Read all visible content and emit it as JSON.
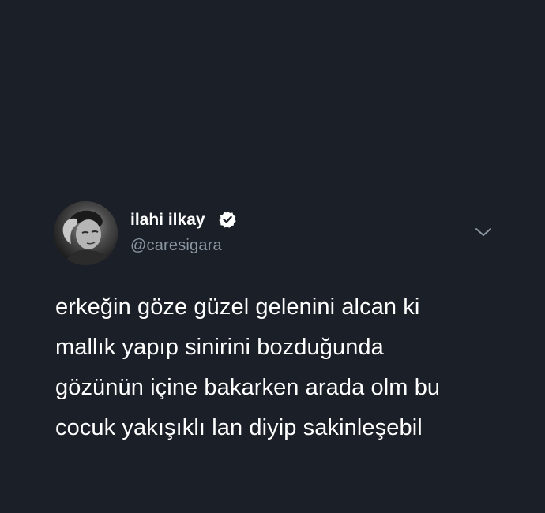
{
  "tweet": {
    "author": {
      "display_name": "ilahi ilkay",
      "handle": "@caresigara",
      "verified": true,
      "avatar": "profile-photo"
    },
    "menu_icon": "chevron-down-icon",
    "text_lines": [
      "erkeğin göze güzel gelenini alcan ki",
      "mallık yapıp sinirini bozduğunda",
      "gözünün içine bakarken arada olm bu",
      "cocuk yakışıklı lan diyip sakinleşebil"
    ]
  },
  "colors": {
    "background": "#1b1f27",
    "text": "#ffffff",
    "handle": "#8b96a3",
    "chevron": "#8b96a3"
  }
}
